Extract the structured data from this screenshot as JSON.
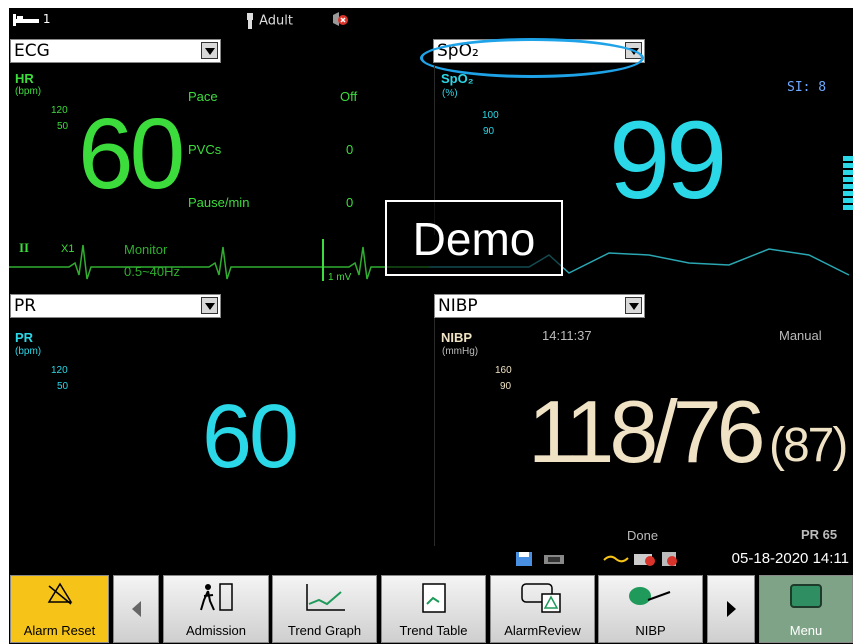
{
  "topbar": {
    "bed": "1",
    "patient_type": "Adult"
  },
  "ecg": {
    "selector": "ECG",
    "hr_label": "HR",
    "hr_unit": "(bpm)",
    "hr_high": "120",
    "hr_low": "50",
    "hr_value": "60",
    "pace_label": "Pace",
    "pace_value": "Off",
    "pvcs_label": "PVCs",
    "pvcs_value": "0",
    "pause_label": "Pause/min",
    "pause_value": "0",
    "lead": "II",
    "gain": "X1",
    "mode": "Monitor",
    "filter": "0.5~40Hz",
    "scale": "1 mV"
  },
  "spo2": {
    "selector": "SpO₂",
    "label": "SpO₂",
    "unit": "(%)",
    "high": "100",
    "low": "90",
    "value": "99",
    "si": "SI: 8"
  },
  "demo_label": "Demo",
  "pr": {
    "selector": "PR",
    "label": "PR",
    "unit": "(bpm)",
    "high": "120",
    "low": "50",
    "value": "60"
  },
  "nibp": {
    "selector": "NIBP",
    "label": "NIBP",
    "unit": "(mmHg)",
    "time": "14:11:37",
    "mode": "Manual",
    "high": "160",
    "low": "90",
    "value": "118/76",
    "mean": "(87)",
    "status": "Done",
    "pr": "PR 65"
  },
  "status": {
    "datetime": "05-18-2020 14:11"
  },
  "buttons": {
    "alarm_reset": "Alarm Reset",
    "admission": "Admission",
    "trend_graph": "Trend Graph",
    "trend_table": "Trend Table",
    "alarm_review": "AlarmReview",
    "nibp": "NIBP",
    "menu": "Menu"
  },
  "colors": {
    "hr": "#3ddc3d",
    "spo2": "#2bd8e8",
    "nibp": "#f0e2c4",
    "alarm_button": "#f6c418",
    "highlight_ring": "#1fa3e8"
  }
}
